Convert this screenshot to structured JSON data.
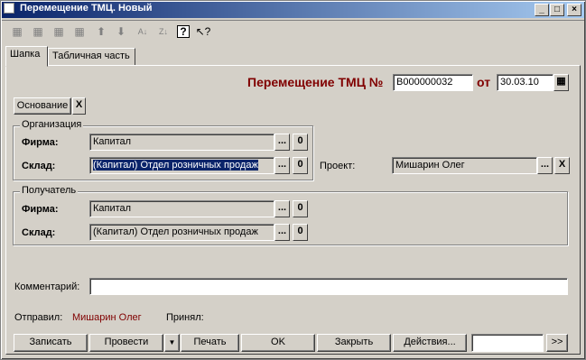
{
  "window": {
    "title": "Перемещение ТМЦ. Новый",
    "controls": {
      "minimize": "_",
      "maximize": "□",
      "close": "×"
    }
  },
  "toolbar": {
    "icons": [
      "add-row-icon",
      "copy-row-icon",
      "delete-row-icon",
      "edit-row-icon",
      "move-up-icon",
      "move-down-icon",
      "sort-asc-icon",
      "sort-desc-icon",
      "help-icon",
      "context-help-icon"
    ]
  },
  "tabs": [
    {
      "label": "Шапка",
      "active": true
    },
    {
      "label": "Табличная часть",
      "active": false
    }
  ],
  "header": {
    "doc_title": "Перемещение ТМЦ №",
    "doc_number": "В000000032",
    "date_label": "от",
    "date_value": "30.03.10"
  },
  "basis": {
    "button_label": "Основание",
    "clear_label": "X"
  },
  "organization": {
    "group_title": "Организация",
    "firm_label": "Фирма:",
    "firm_value": "Капитал",
    "warehouse_label": "Склад:",
    "warehouse_value": "(Капитал) Отдел розничных продаж"
  },
  "project": {
    "label": "Проект:",
    "value": "Мишарин Олег"
  },
  "recipient": {
    "group_title": "Получатель",
    "firm_label": "Фирма:",
    "firm_value": "Капитал",
    "warehouse_label": "Склад:",
    "warehouse_value": "(Капитал) Отдел розничных продаж"
  },
  "comment": {
    "label": "Комментарий:",
    "value": ""
  },
  "sender": {
    "label": "Отправил:",
    "value": "Мишарин Олег"
  },
  "receiver": {
    "label": "Принял:",
    "value": ""
  },
  "buttons": {
    "save": "Записать",
    "post": "Провести",
    "print": "Печать",
    "ok": "OK",
    "close": "Закрыть",
    "actions": "Действия...",
    "more": ">>",
    "dots": "...",
    "zero": "0",
    "x": "X"
  }
}
